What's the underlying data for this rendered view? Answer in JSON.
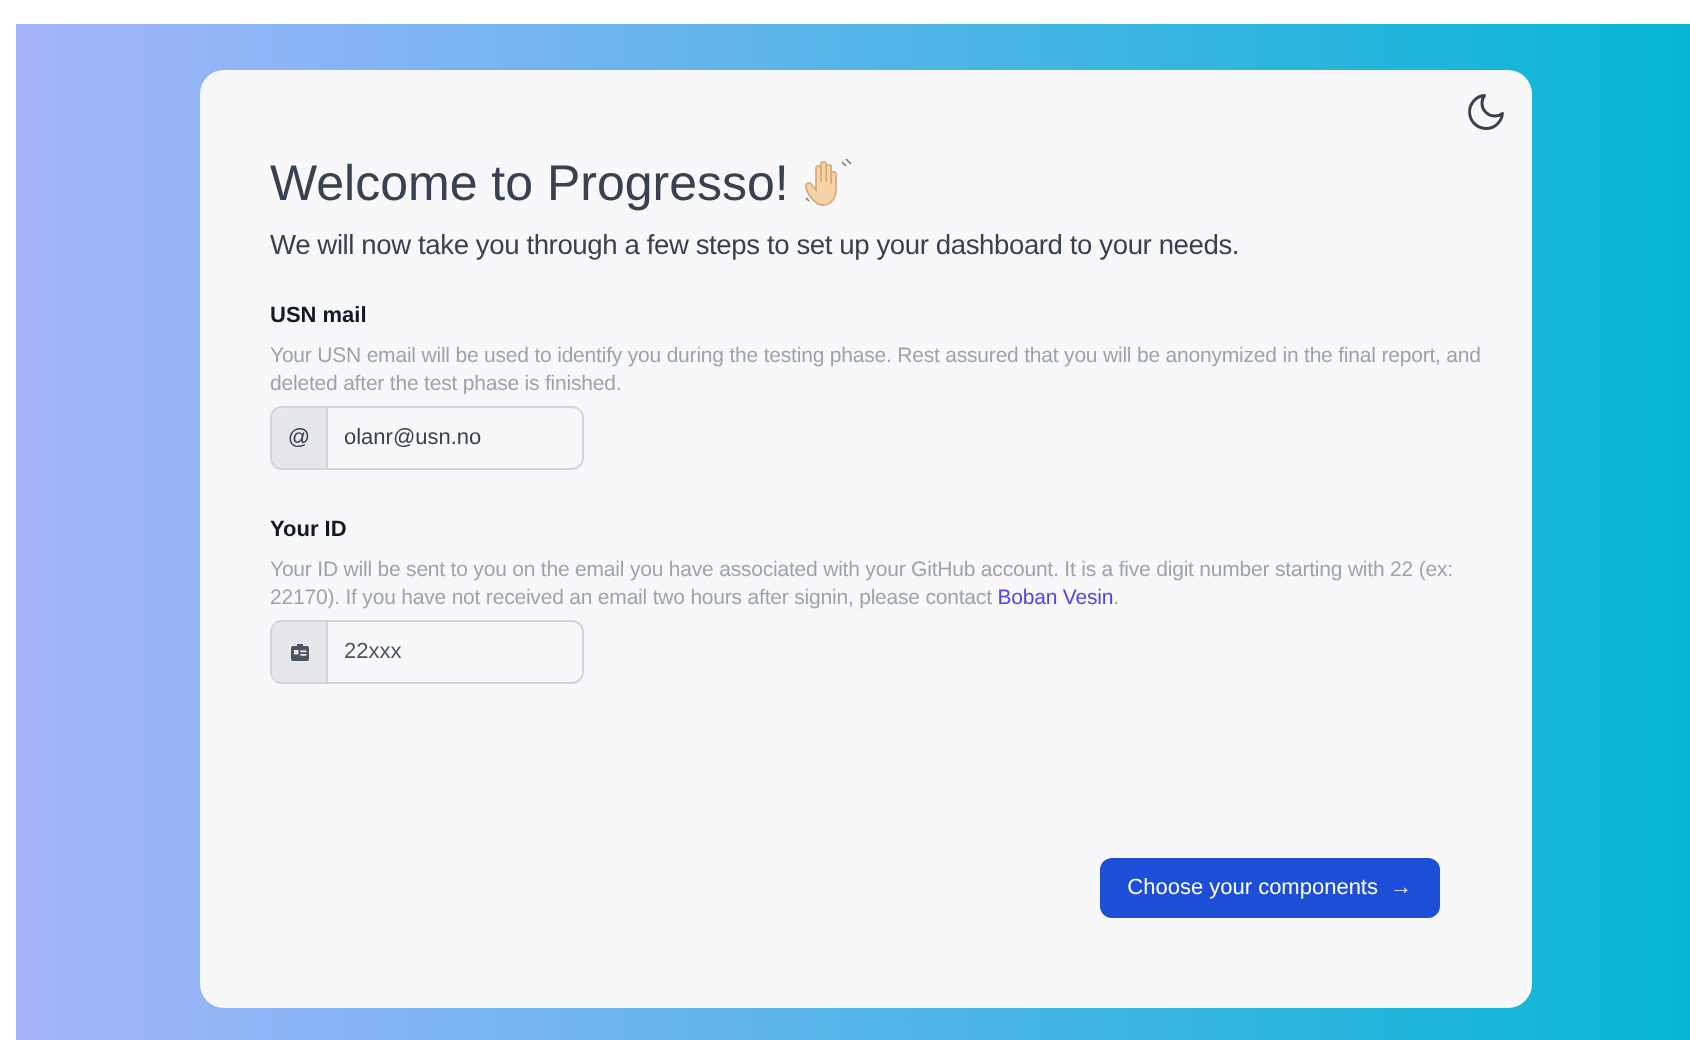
{
  "header": {
    "title": "Welcome to Progresso!",
    "subtitle": "We will now take you through a few steps to set up your dashboard to your needs."
  },
  "fields": [
    {
      "label": "USN mail",
      "help": "Your USN email will be used to identify you during the testing phase. Rest assured that you will be anonymized in the final report, and deleted after the test phase is finished.",
      "addon": {
        "kind": "text",
        "text": "@"
      },
      "value": "olanr@usn.no"
    },
    {
      "label": "Your ID",
      "help": "Your ID will be sent to you on the email you have associated with your GitHub account. It is a five digit number starting with 22 (ex: 22170). If you have not received an email two hours after signin, please contact ",
      "link": "Boban Vesin",
      "help_end": ".",
      "addon": {
        "kind": "icon"
      },
      "placeholder": "22xxx"
    }
  ],
  "button": {
    "label": "Choose your components",
    "arrow": "→"
  }
}
